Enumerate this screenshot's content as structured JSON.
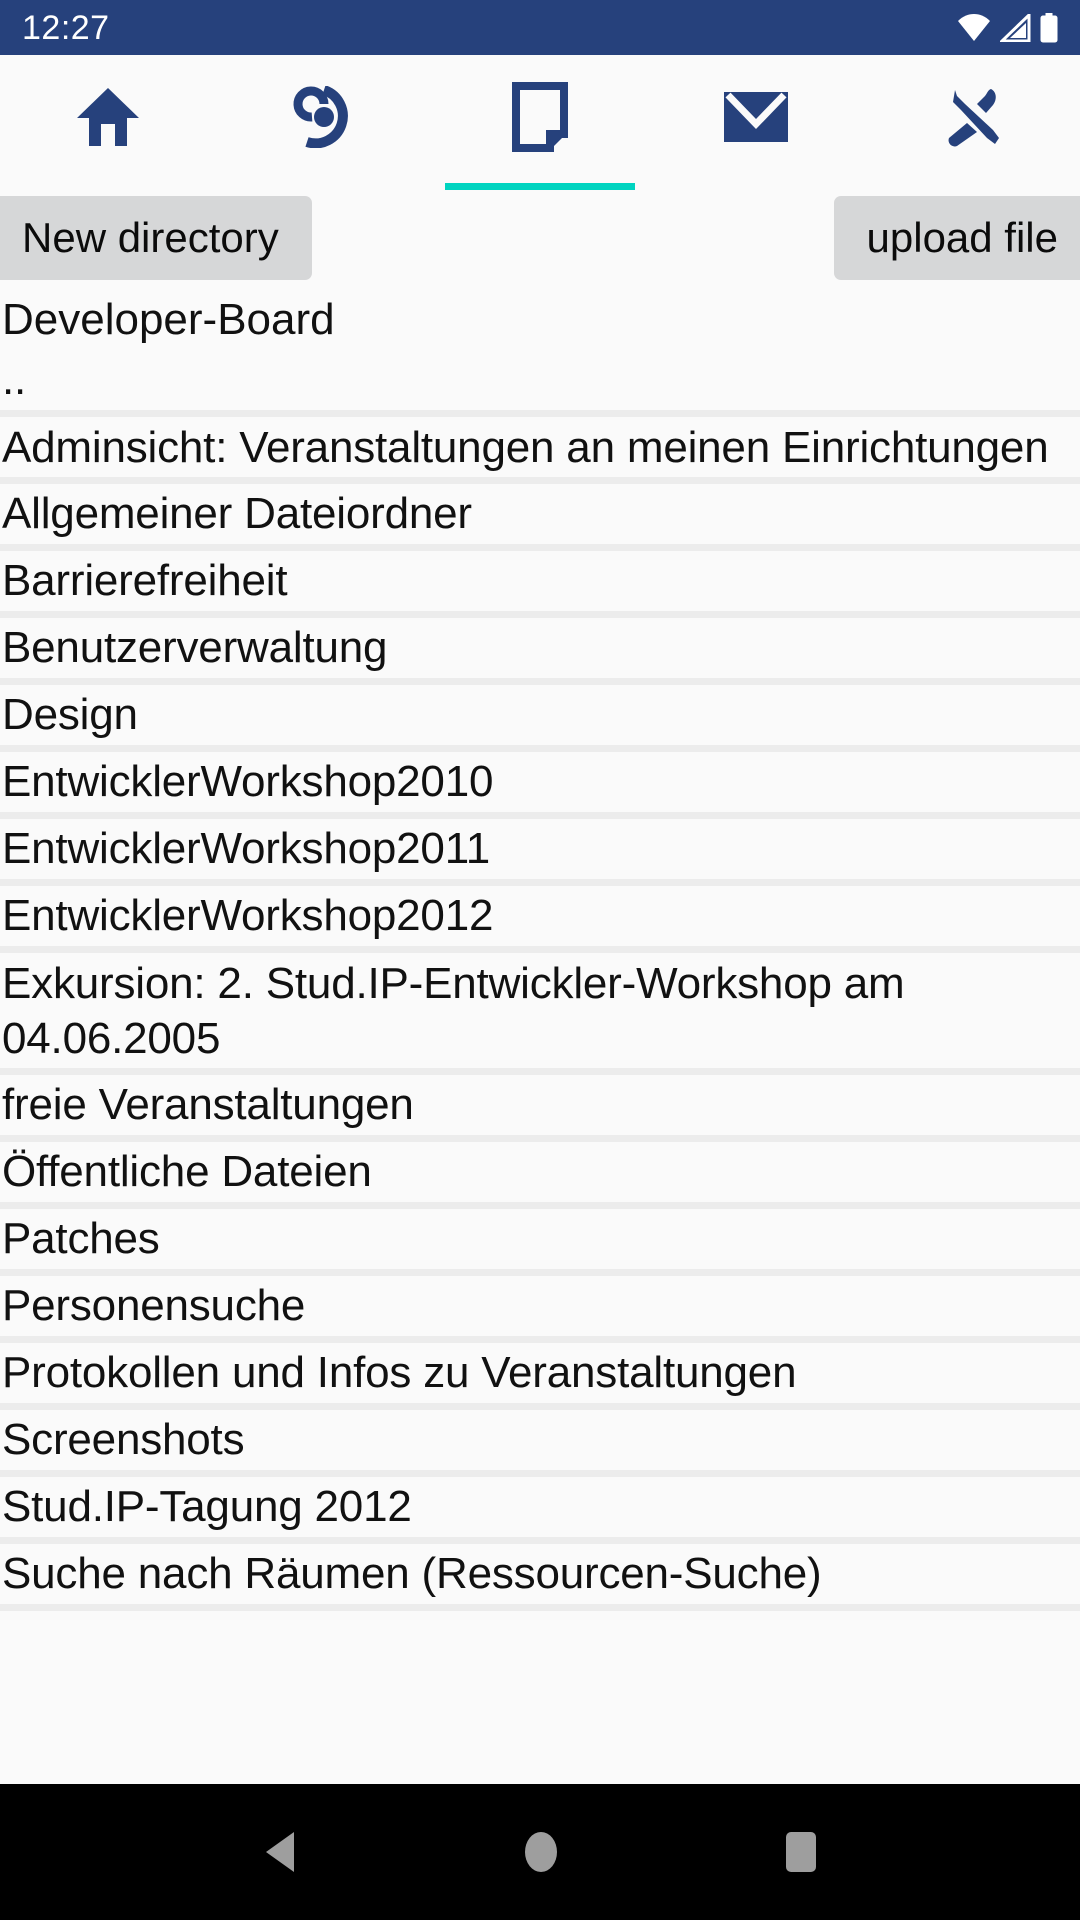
{
  "statusbar": {
    "time": "12:27",
    "icons": [
      "wifi-icon",
      "cellular-signal-icon",
      "battery-icon"
    ],
    "background_color": "#26417c",
    "foreground_color": "#ffffff"
  },
  "tabbar": {
    "active_index": 2,
    "accent_color": "#00d4c0",
    "icon_color": "#26417c",
    "tabs": [
      {
        "name": "home",
        "icon": "home-icon"
      },
      {
        "name": "activity",
        "icon": "spiral-eye-icon"
      },
      {
        "name": "files",
        "icon": "document-page-icon"
      },
      {
        "name": "messages",
        "icon": "envelope-icon"
      },
      {
        "name": "tools",
        "icon": "tools-crossed-icon"
      }
    ]
  },
  "toolbar": {
    "new_directory_label": "New directory",
    "upload_file_label": "upload file",
    "button_color": "#d6d7d8"
  },
  "folder": {
    "title": "Developer-Board"
  },
  "filelist": {
    "items": [
      {
        "label": "..",
        "lines": 1
      },
      {
        "label": "Adminsicht: Veranstaltungen an meinen Einrichtungen",
        "lines": 2
      },
      {
        "label": "Allgemeiner Dateiordner",
        "lines": 1
      },
      {
        "label": "Barrierefreiheit",
        "lines": 1
      },
      {
        "label": "Benutzerverwaltung",
        "lines": 1
      },
      {
        "label": "Design",
        "lines": 1
      },
      {
        "label": "EntwicklerWorkshop2010",
        "lines": 1
      },
      {
        "label": "EntwicklerWorkshop2011",
        "lines": 1
      },
      {
        "label": "EntwicklerWorkshop2012",
        "lines": 1
      },
      {
        "label": "Exkursion: 2. Stud.IP-Entwickler-Workshop am 04.06.2005",
        "lines": 2
      },
      {
        "label": "freie Veranstaltungen",
        "lines": 1
      },
      {
        "label": "Öffentliche Dateien",
        "lines": 1
      },
      {
        "label": "Patches",
        "lines": 1
      },
      {
        "label": "Personensuche",
        "lines": 1
      },
      {
        "label": "Protokollen und Infos zu Veranstaltungen",
        "lines": 1
      },
      {
        "label": "Screenshots",
        "lines": 1
      },
      {
        "label": "Stud.IP-Tagung 2012",
        "lines": 1
      },
      {
        "label": "Suche nach Räumen (Ressourcen-Suche)",
        "lines": 1
      }
    ]
  },
  "navbar": {
    "background_color": "#000000",
    "buttons": [
      {
        "name": "back",
        "icon": "back-triangle-icon"
      },
      {
        "name": "home",
        "icon": "home-circle-icon"
      },
      {
        "name": "recents",
        "icon": "recents-square-icon"
      }
    ]
  }
}
